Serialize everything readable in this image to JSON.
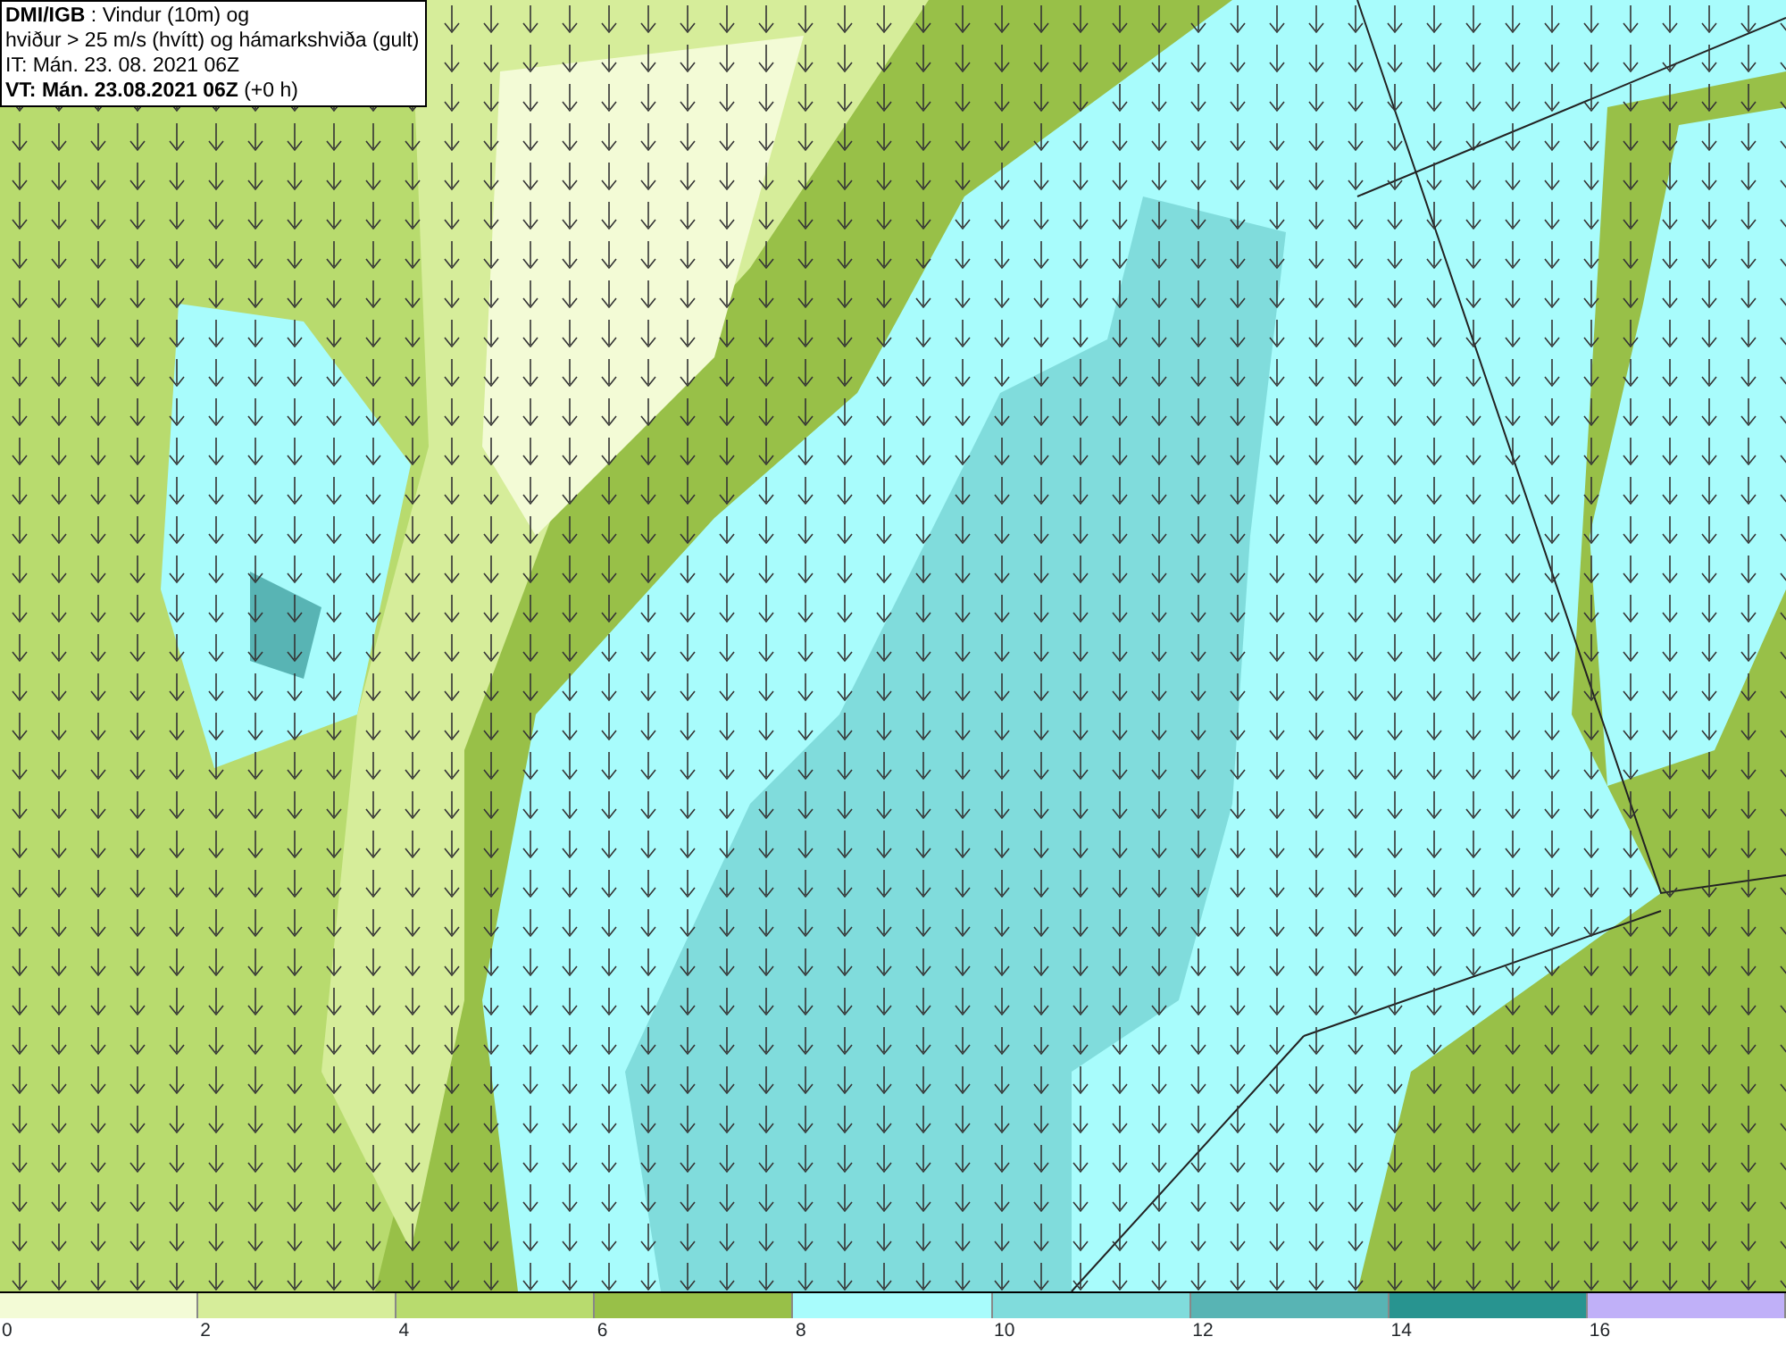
{
  "title_box": {
    "lines": [
      {
        "text": "**DMI/IGB** : Vindur (10m) og"
      },
      {
        "text": "hviður > 25 m/s (hvítt) og hámarkshviða (gult)"
      },
      {
        "text": "IT: Mán. 23. 08. 2021 06Z"
      },
      {
        "text": "**VT: Mán. 23.08.2021 06Z** (+0 h)"
      }
    ]
  },
  "legend": {
    "bins": [
      {
        "label": "0",
        "color": "#f3fbd6"
      },
      {
        "label": "2",
        "color": "#d6ed9a"
      },
      {
        "label": "4",
        "color": "#b8db6e"
      },
      {
        "label": "6",
        "color": "#98c048"
      },
      {
        "label": "8",
        "color": "#a8fcfc"
      },
      {
        "label": "10",
        "color": "#80dcdc"
      },
      {
        "label": "12",
        "color": "#58b4b4"
      },
      {
        "label": "14",
        "color": "#289490"
      },
      {
        "label": "16",
        "color": "#c0b0f8"
      }
    ]
  }
}
